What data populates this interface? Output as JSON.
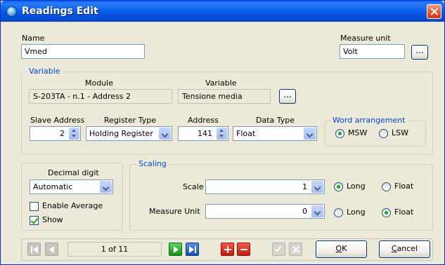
{
  "window": {
    "title": "Readings Edit"
  },
  "name": {
    "label": "Name",
    "value": "Vmed"
  },
  "measure_unit": {
    "label": "Measure unit",
    "value": "Volt",
    "browse_label": "..."
  },
  "variable_group": {
    "title": "Variable",
    "module_label": "Module",
    "module_value": "S-203TA - n.1 - Address 2",
    "variable_label": "Variable",
    "variable_value": "Tensione media",
    "browse_label": "...",
    "slave_address_label": "Slave Address",
    "slave_address_value": "2",
    "register_type_label": "Register Type",
    "register_type_value": "Holding Register",
    "address_label": "Address",
    "address_value": "141",
    "data_type_label": "Data Type",
    "data_type_value": "Float"
  },
  "word_arrangement": {
    "title": "Word arrangement",
    "msw_label": "MSW",
    "lsw_label": "LSW",
    "selected": "MSW"
  },
  "decimal": {
    "label": "Decimal digit",
    "value": "Automatic",
    "enable_average_label": "Enable Average",
    "enable_average_checked": false,
    "show_label": "Show",
    "show_checked": true
  },
  "scaling": {
    "title": "Scaling",
    "scale_label": "Scale",
    "scale_value": "1",
    "scale_long_label": "Long",
    "scale_float_label": "Float",
    "scale_selected": "Long",
    "mu_label": "Measure Unit",
    "mu_value": "0",
    "mu_long_label": "Long",
    "mu_float_label": "Float",
    "mu_selected": "Float"
  },
  "navigator": {
    "position_text": "1 of 11"
  },
  "buttons": {
    "ok_label": "OK",
    "cancel_label": "Cancel"
  },
  "icons": [
    "app-icon",
    "close-icon",
    "first-record-icon",
    "previous-record-icon",
    "next-record-icon",
    "last-record-icon",
    "add-record-icon",
    "delete-record-icon",
    "confirm-edit-icon",
    "cancel-edit-icon"
  ]
}
